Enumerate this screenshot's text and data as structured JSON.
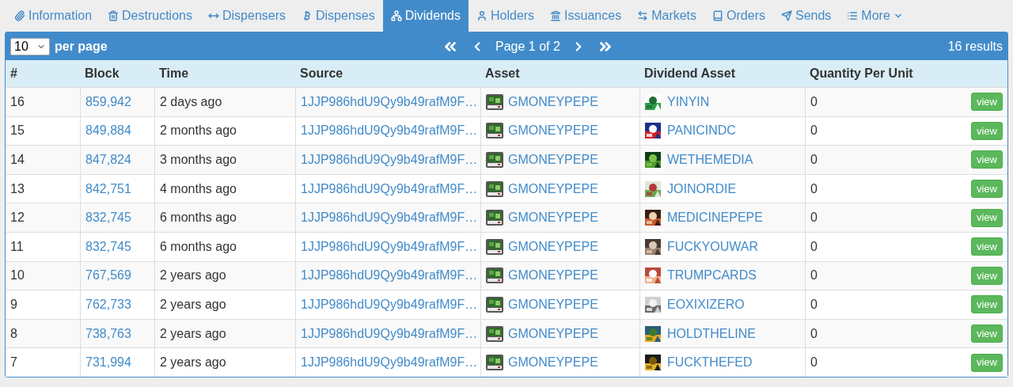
{
  "tabs": [
    {
      "label": "Information",
      "selected": false
    },
    {
      "label": "Destructions",
      "selected": false
    },
    {
      "label": "Dispensers",
      "selected": false
    },
    {
      "label": "Dispenses",
      "selected": false
    },
    {
      "label": "Dividends",
      "selected": true
    },
    {
      "label": "Holders",
      "selected": false
    },
    {
      "label": "Issuances",
      "selected": false
    },
    {
      "label": "Markets",
      "selected": false
    },
    {
      "label": "Orders",
      "selected": false
    },
    {
      "label": "Sends",
      "selected": false
    },
    {
      "label": "More",
      "selected": false
    }
  ],
  "toolbar": {
    "per_page_value": "10",
    "per_page_label": "per page",
    "page_label": "Page 1 of 2",
    "results": "16 results"
  },
  "table": {
    "columns": [
      "#",
      "Block",
      "Time",
      "Source",
      "Asset",
      "Dividend Asset",
      "Quantity Per Unit"
    ],
    "rows": [
      {
        "index": "16",
        "block": "859,942",
        "time": "2 days ago",
        "source": "1JJP986hdU9Qy9b49rafM9F…",
        "asset": "GMONEYPEPE",
        "dividend_asset": "YINYIN",
        "quantity": "0",
        "action": "view"
      },
      {
        "index": "15",
        "block": "849,884",
        "time": "2 months ago",
        "source": "1JJP986hdU9Qy9b49rafM9F…",
        "asset": "GMONEYPEPE",
        "dividend_asset": "PANICINDC",
        "quantity": "0",
        "action": "view"
      },
      {
        "index": "14",
        "block": "847,824",
        "time": "3 months ago",
        "source": "1JJP986hdU9Qy9b49rafM9F…",
        "asset": "GMONEYPEPE",
        "dividend_asset": "WETHEMEDIA",
        "quantity": "0",
        "action": "view"
      },
      {
        "index": "13",
        "block": "842,751",
        "time": "4 months ago",
        "source": "1JJP986hdU9Qy9b49rafM9F…",
        "asset": "GMONEYPEPE",
        "dividend_asset": "JOINORDIE",
        "quantity": "0",
        "action": "view"
      },
      {
        "index": "12",
        "block": "832,745",
        "time": "6 months ago",
        "source": "1JJP986hdU9Qy9b49rafM9F…",
        "asset": "GMONEYPEPE",
        "dividend_asset": "MEDICINEPEPE",
        "quantity": "0",
        "action": "view"
      },
      {
        "index": "11",
        "block": "832,745",
        "time": "6 months ago",
        "source": "1JJP986hdU9Qy9b49rafM9F…",
        "asset": "GMONEYPEPE",
        "dividend_asset": "FUCKYOUWAR",
        "quantity": "0",
        "action": "view"
      },
      {
        "index": "10",
        "block": "767,569",
        "time": "2 years ago",
        "source": "1JJP986hdU9Qy9b49rafM9F…",
        "asset": "GMONEYPEPE",
        "dividend_asset": "TRUMPCARDS",
        "quantity": "0",
        "action": "view"
      },
      {
        "index": "9",
        "block": "762,733",
        "time": "2 years ago",
        "source": "1JJP986hdU9Qy9b49rafM9F…",
        "asset": "GMONEYPEPE",
        "dividend_asset": "EOXIXIZERO",
        "quantity": "0",
        "action": "view"
      },
      {
        "index": "8",
        "block": "738,763",
        "time": "2 years ago",
        "source": "1JJP986hdU9Qy9b49rafM9F…",
        "asset": "GMONEYPEPE",
        "dividend_asset": "HOLDTHELINE",
        "quantity": "0",
        "action": "view"
      },
      {
        "index": "7",
        "block": "731,994",
        "time": "2 years ago",
        "source": "1JJP986hdU9Qy9b49rafM9F…",
        "asset": "GMONEYPEPE",
        "dividend_asset": "FUCKTHEFED",
        "quantity": "0",
        "action": "view"
      }
    ]
  }
}
